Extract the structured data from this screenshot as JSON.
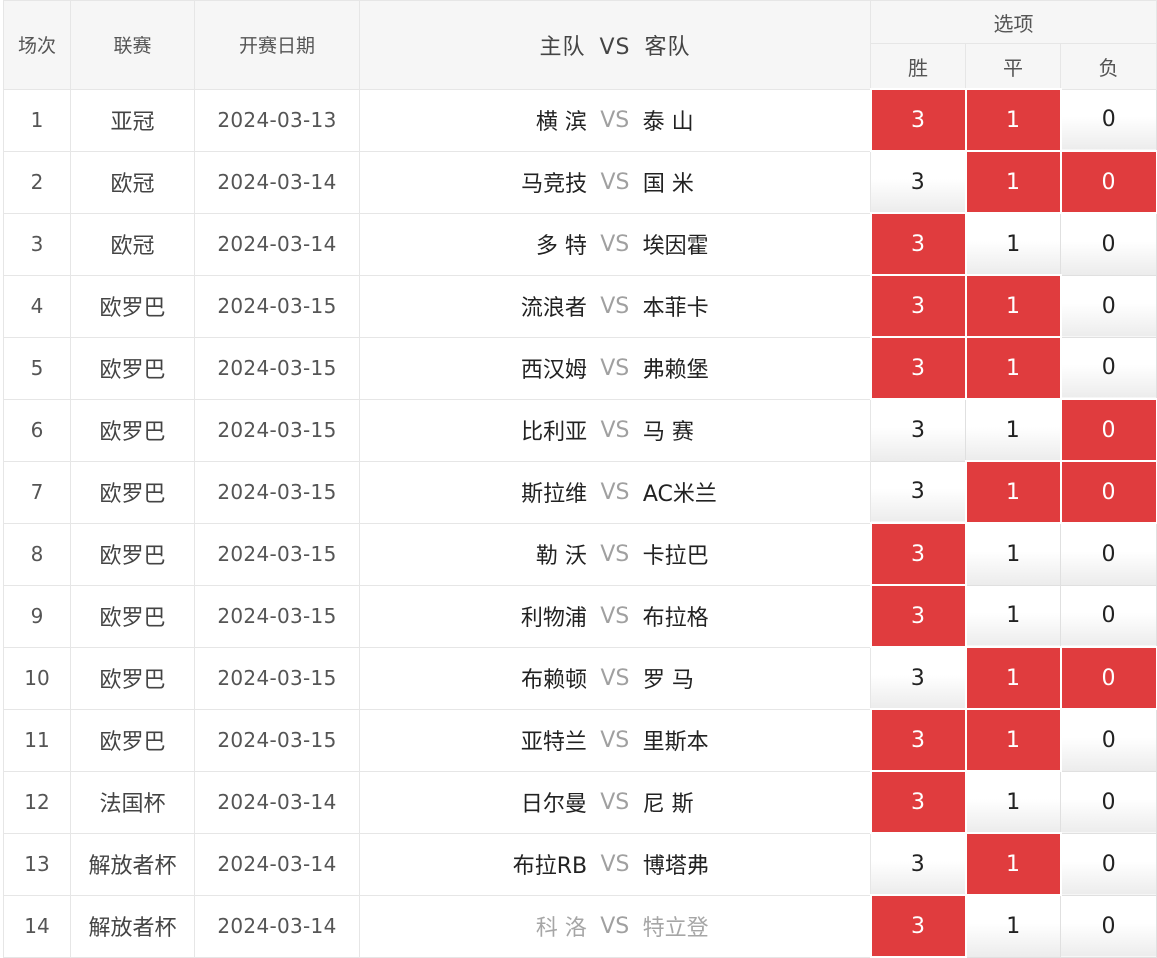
{
  "header": {
    "col_index": "场次",
    "col_league": "联赛",
    "col_date": "开赛日期",
    "col_home": "主队",
    "col_vs": "VS",
    "col_away": "客队",
    "col_options": "选项",
    "opt_win": "胜",
    "opt_draw": "平",
    "opt_loss": "负"
  },
  "colors": {
    "selected": "#e03c3e",
    "vs_text": "#a0a0a0",
    "dim_team": "#a6a6a6"
  },
  "rows": [
    {
      "no": "1",
      "league": "亚冠",
      "date": "2024-03-13",
      "home": "横 滨",
      "vs": "VS",
      "away": "泰 山",
      "win": "3",
      "draw": "1",
      "loss": "0",
      "sel": [
        true,
        true,
        false
      ],
      "dim": false
    },
    {
      "no": "2",
      "league": "欧冠",
      "date": "2024-03-14",
      "home": "马竞技",
      "vs": "VS",
      "away": "国 米",
      "win": "3",
      "draw": "1",
      "loss": "0",
      "sel": [
        false,
        true,
        true
      ],
      "dim": false
    },
    {
      "no": "3",
      "league": "欧冠",
      "date": "2024-03-14",
      "home": "多 特",
      "vs": "VS",
      "away": "埃因霍",
      "win": "3",
      "draw": "1",
      "loss": "0",
      "sel": [
        true,
        false,
        false
      ],
      "dim": false
    },
    {
      "no": "4",
      "league": "欧罗巴",
      "date": "2024-03-15",
      "home": "流浪者",
      "vs": "VS",
      "away": "本菲卡",
      "win": "3",
      "draw": "1",
      "loss": "0",
      "sel": [
        true,
        true,
        false
      ],
      "dim": false
    },
    {
      "no": "5",
      "league": "欧罗巴",
      "date": "2024-03-15",
      "home": "西汉姆",
      "vs": "VS",
      "away": "弗赖堡",
      "win": "3",
      "draw": "1",
      "loss": "0",
      "sel": [
        true,
        true,
        false
      ],
      "dim": false
    },
    {
      "no": "6",
      "league": "欧罗巴",
      "date": "2024-03-15",
      "home": "比利亚",
      "vs": "VS",
      "away": "马 赛",
      "win": "3",
      "draw": "1",
      "loss": "0",
      "sel": [
        false,
        false,
        true
      ],
      "dim": false
    },
    {
      "no": "7",
      "league": "欧罗巴",
      "date": "2024-03-15",
      "home": "斯拉维",
      "vs": "VS",
      "away": "AC米兰",
      "win": "3",
      "draw": "1",
      "loss": "0",
      "sel": [
        false,
        true,
        true
      ],
      "dim": false
    },
    {
      "no": "8",
      "league": "欧罗巴",
      "date": "2024-03-15",
      "home": "勒 沃",
      "vs": "VS",
      "away": "卡拉巴",
      "win": "3",
      "draw": "1",
      "loss": "0",
      "sel": [
        true,
        false,
        false
      ],
      "dim": false
    },
    {
      "no": "9",
      "league": "欧罗巴",
      "date": "2024-03-15",
      "home": "利物浦",
      "vs": "VS",
      "away": "布拉格",
      "win": "3",
      "draw": "1",
      "loss": "0",
      "sel": [
        true,
        false,
        false
      ],
      "dim": false
    },
    {
      "no": "10",
      "league": "欧罗巴",
      "date": "2024-03-15",
      "home": "布赖顿",
      "vs": "VS",
      "away": "罗 马",
      "win": "3",
      "draw": "1",
      "loss": "0",
      "sel": [
        false,
        true,
        true
      ],
      "dim": false
    },
    {
      "no": "11",
      "league": "欧罗巴",
      "date": "2024-03-15",
      "home": "亚特兰",
      "vs": "VS",
      "away": "里斯本",
      "win": "3",
      "draw": "1",
      "loss": "0",
      "sel": [
        true,
        true,
        false
      ],
      "dim": false
    },
    {
      "no": "12",
      "league": "法国杯",
      "date": "2024-03-14",
      "home": "日尔曼",
      "vs": "VS",
      "away": "尼 斯",
      "win": "3",
      "draw": "1",
      "loss": "0",
      "sel": [
        true,
        false,
        false
      ],
      "dim": false
    },
    {
      "no": "13",
      "league": "解放者杯",
      "date": "2024-03-14",
      "home": "布拉RB",
      "vs": "VS",
      "away": "博塔弗",
      "win": "3",
      "draw": "1",
      "loss": "0",
      "sel": [
        false,
        true,
        false
      ],
      "dim": false
    },
    {
      "no": "14",
      "league": "解放者杯",
      "date": "2024-03-14",
      "home": "科 洛",
      "vs": "VS",
      "away": "特立登",
      "win": "3",
      "draw": "1",
      "loss": "0",
      "sel": [
        true,
        false,
        false
      ],
      "dim": true
    }
  ]
}
